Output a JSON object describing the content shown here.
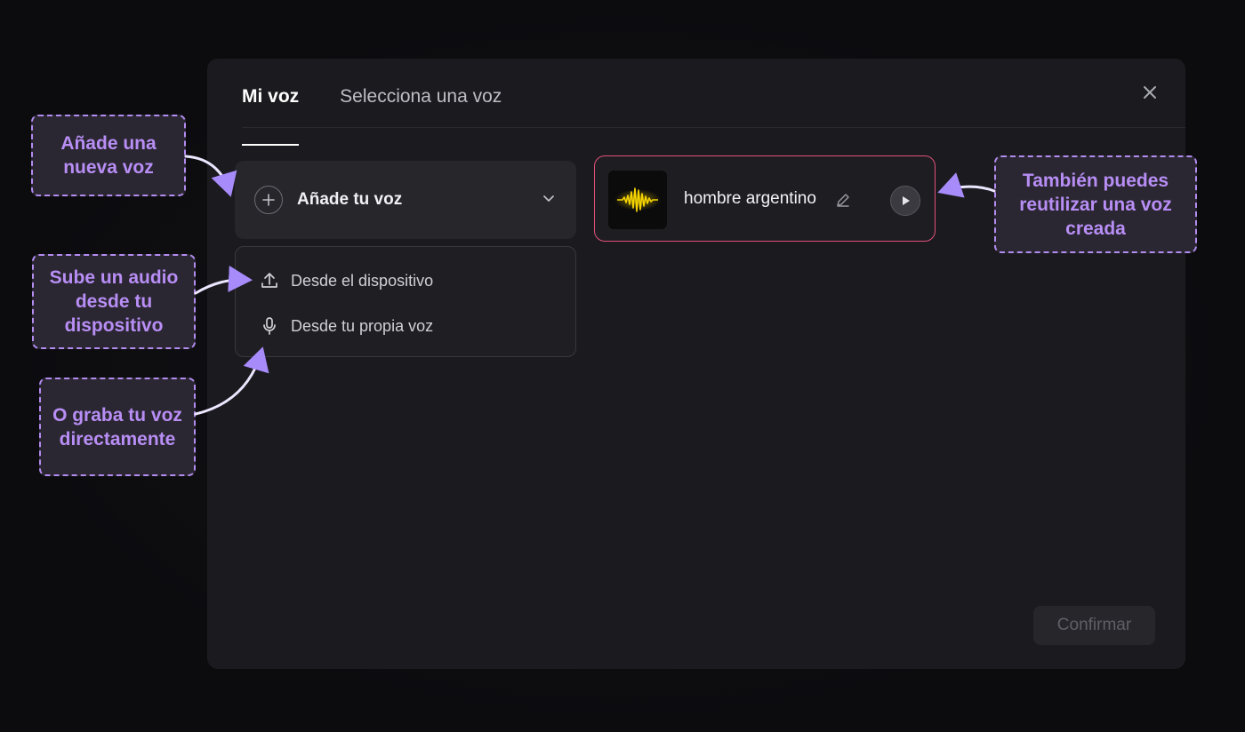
{
  "modal": {
    "tabs": [
      {
        "label": "Mi voz",
        "active": true
      },
      {
        "label": "Selecciona una voz",
        "active": false
      }
    ],
    "close_icon": "close-icon"
  },
  "add_voice": {
    "label": "Añade tu voz",
    "icon": "plus-circle-icon",
    "chevron": "chevron-down-icon"
  },
  "menu": {
    "items": [
      {
        "label": "Desde el dispositivo",
        "icon": "upload-icon"
      },
      {
        "label": "Desde tu propia voz",
        "icon": "microphone-icon"
      }
    ]
  },
  "voice_card": {
    "name": "hombre argentino",
    "thumb_icon": "waveform-icon",
    "edit_icon": "pencil-icon",
    "play_icon": "play-icon"
  },
  "confirm_label": "Confirmar",
  "annotations": {
    "add_new": "Añade una nueva voz",
    "upload": "Sube un audio desde tu dispositivo",
    "record": "O graba tu voz directamente",
    "reuse": "También puedes reutilizar una voz creada"
  },
  "colors": {
    "accent_border": "#e0507a",
    "callout_text": "#b88ef5",
    "waveform": "#f5d400"
  }
}
